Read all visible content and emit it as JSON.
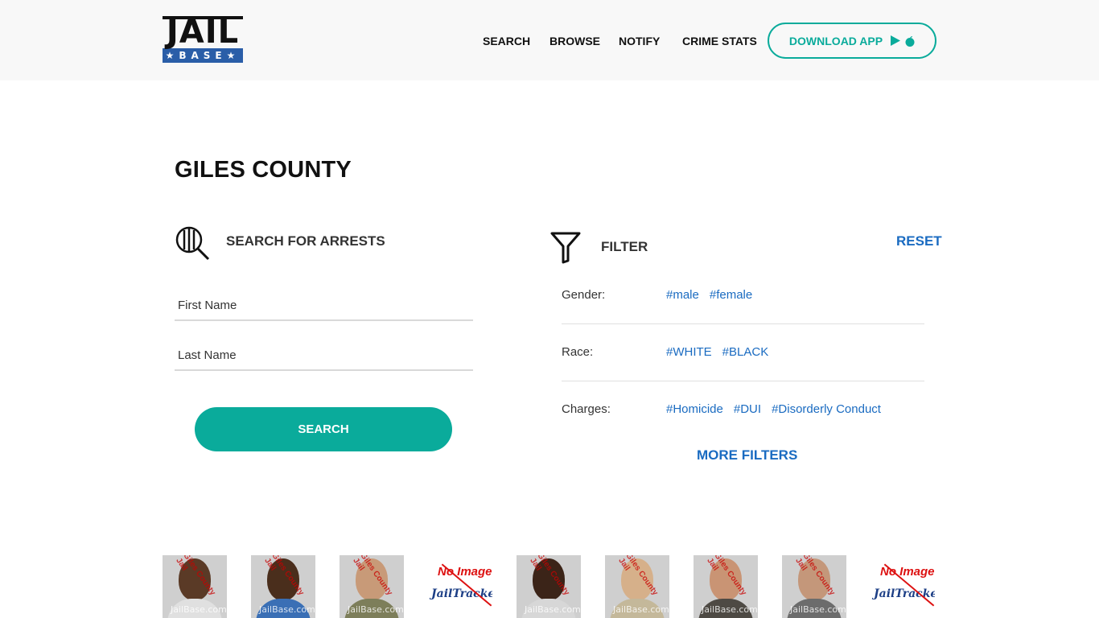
{
  "header": {
    "logo_top": "JAIL",
    "logo_bottom": "★BASE★",
    "nav": [
      "SEARCH",
      "BROWSE",
      "NOTIFY",
      "CRIME STATS"
    ],
    "download_label": "DOWNLOAD APP",
    "accent_color": "#0aab9b"
  },
  "page": {
    "title": "GILES COUNTY"
  },
  "search": {
    "heading": "SEARCH FOR ARRESTS",
    "first_name_placeholder": "First Name",
    "last_name_placeholder": "Last Name",
    "button_label": "SEARCH",
    "icon": "magnifier-bars-icon"
  },
  "filter": {
    "heading": "FILTER",
    "reset_label": "RESET",
    "more_label": "MORE FILTERS",
    "link_color": "#1a6bc1",
    "rows": [
      {
        "name": "Gender:",
        "tags": [
          "#male",
          "#female"
        ]
      },
      {
        "name": "Race:",
        "tags": [
          "#WHITE",
          "#BLACK"
        ]
      },
      {
        "name": "Charges:",
        "tags": [
          "#Homicide",
          "#DUI",
          "#Disorderly Conduct"
        ]
      }
    ]
  },
  "mugshots": {
    "watermark": "JailBase.com",
    "stamp": "Giles County Jail",
    "no_image_title": "No Image",
    "no_image_brand": "JailTracker",
    "items": [
      {
        "type": "photo"
      },
      {
        "type": "photo"
      },
      {
        "type": "photo"
      },
      {
        "type": "none"
      },
      {
        "type": "photo"
      },
      {
        "type": "photo"
      },
      {
        "type": "photo"
      },
      {
        "type": "photo"
      },
      {
        "type": "none"
      }
    ]
  }
}
